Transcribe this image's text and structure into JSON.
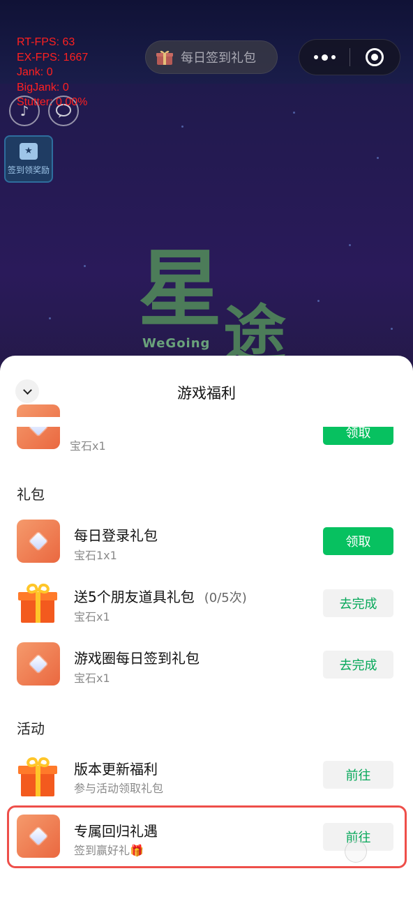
{
  "perf": {
    "rt_fps": "RT-FPS: 63",
    "ex_fps": "EX-FPS: 1667",
    "jank": "Jank: 0",
    "bigjank": "BigJank: 0",
    "stutter": "Stutter: 0.00%"
  },
  "top": {
    "checkin_pill": "每日签到礼包",
    "sign_reward": "签到领奖励"
  },
  "game_logo": {
    "big_char": "星",
    "second_char": "途",
    "latin": "WeGoing"
  },
  "sheet": {
    "title": "游戏福利",
    "partial_item": {
      "sub": "宝石x1",
      "button": "领取"
    },
    "sections": [
      {
        "label": "礼包",
        "items": [
          {
            "title": "每日登录礼包",
            "count": "",
            "sub": "宝石1x1",
            "button": "领取",
            "button_style": "green",
            "icon": "diamond-icon"
          },
          {
            "title": "送5个朋友道具礼包",
            "count": "(0/5次)",
            "sub": "宝石x1",
            "button": "去完成",
            "button_style": "grey",
            "icon": "gift-icon"
          },
          {
            "title": "游戏圈每日签到礼包",
            "count": "",
            "sub": "宝石x1",
            "button": "去完成",
            "button_style": "grey",
            "icon": "diamond-icon"
          }
        ]
      },
      {
        "label": "活动",
        "items": [
          {
            "title": "版本更新福利",
            "count": "",
            "sub": "参与活动领取礼包",
            "button": "前往",
            "button_style": "grey",
            "icon": "gift-icon"
          },
          {
            "title": "专属回归礼遇",
            "count": "",
            "sub": "签到赢好礼🎁",
            "button": "前往",
            "button_style": "grey",
            "icon": "diamond-icon"
          }
        ]
      }
    ]
  },
  "colors": {
    "accent_green": "#07c160",
    "highlight_red": "#ee4f4a"
  }
}
